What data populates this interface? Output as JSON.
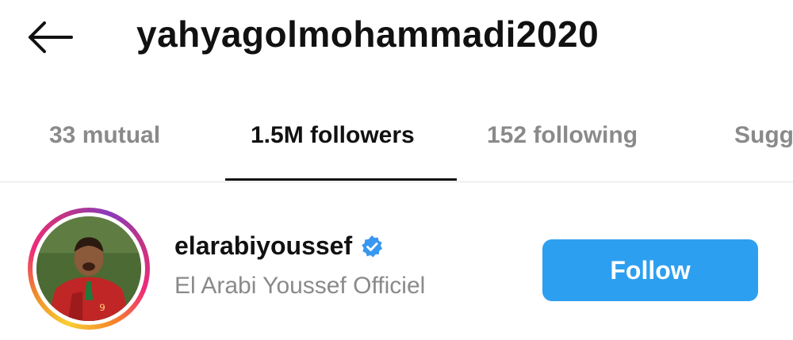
{
  "header": {
    "title": "yahyagolmohammadi2020",
    "back_icon": "arrow-left-icon"
  },
  "tabs": [
    {
      "label": "33 mutual",
      "active": false
    },
    {
      "label": "1.5M followers",
      "active": true
    },
    {
      "label": "152 following",
      "active": false
    },
    {
      "label": "Sugg",
      "active": false
    }
  ],
  "list": {
    "items": [
      {
        "username": "elarabiyoussef",
        "full_name": "El Arabi Youssef Officiel",
        "verified": true,
        "verified_icon": "verified-badge-icon",
        "has_story_ring": true,
        "button_label": "Follow"
      }
    ]
  },
  "colors": {
    "follow_button": "#2d9ff0",
    "verified_badge": "#3897f0",
    "active_tab": "#111111",
    "inactive_tab": "#8a8a8a",
    "secondary_text": "#8a8a8a"
  }
}
